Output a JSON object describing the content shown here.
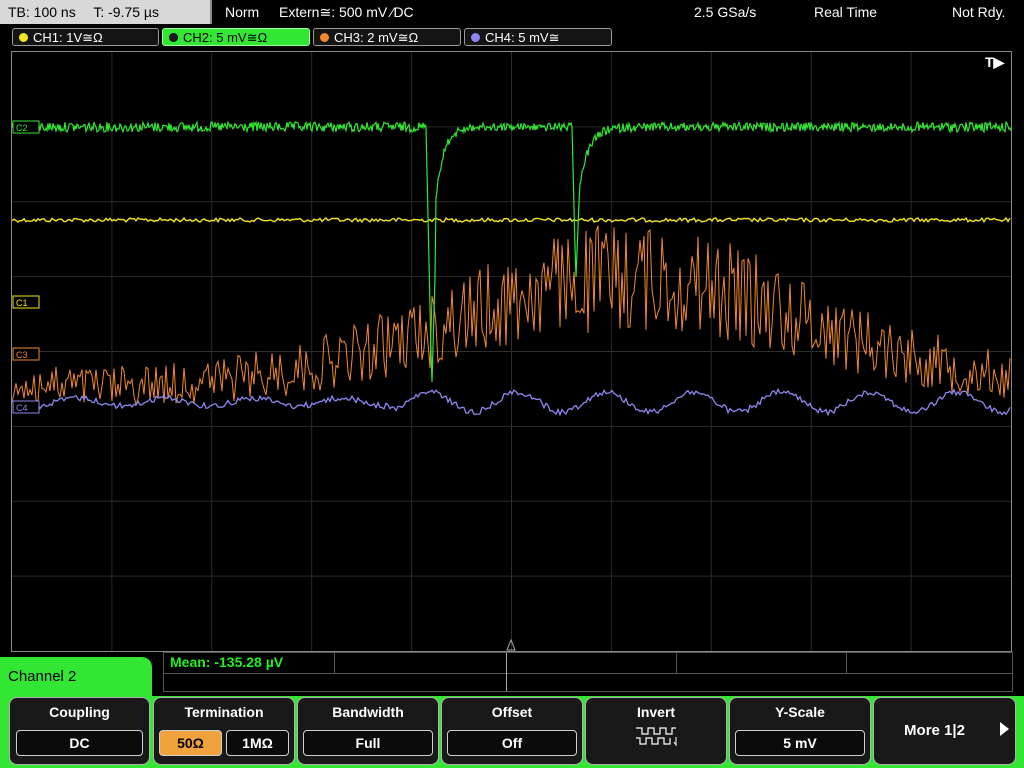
{
  "status": {
    "timebase": "TB: 100 ns",
    "trigger_time": "T: -9.75 µs",
    "trigger_mode": "Norm",
    "trigger_source": "Extern≅: 500 mV ⁄DC",
    "sample_rate": "2.5 GSa/s",
    "acq_mode": "Real Time",
    "state": "Not Rdy."
  },
  "channels": [
    {
      "label": "CH1: 1V≅Ω",
      "color": "#f4e61e"
    },
    {
      "label": "CH2: 5 mV≅Ω",
      "color": "#33e633"
    },
    {
      "label": "CH3: 2 mV≅Ω",
      "color": "#f08a2a"
    },
    {
      "label": "CH4: 5 mV≅",
      "color": "#8d88f0"
    }
  ],
  "markers": {
    "trigger_label": "T▶",
    "ch1": "C1",
    "ch2": "C2",
    "ch3": "C3",
    "ch4": "C4"
  },
  "measure": {
    "mean": "Mean: -135.28 µV"
  },
  "menu": {
    "title": "Channel 2",
    "coupling": {
      "title": "Coupling",
      "value": "DC"
    },
    "termination": {
      "title": "Termination",
      "option_a": "50Ω",
      "option_b": "1MΩ",
      "selected": "50Ω"
    },
    "bandwidth": {
      "title": "Bandwidth",
      "value": "Full"
    },
    "offset": {
      "title": "Offset",
      "value": "Off"
    },
    "invert": {
      "title": "Invert",
      "icon": "invert-waveform-icon"
    },
    "yscale": {
      "title": "Y-Scale",
      "value": "5 mV"
    },
    "more": {
      "label": "More 1|2"
    }
  }
}
